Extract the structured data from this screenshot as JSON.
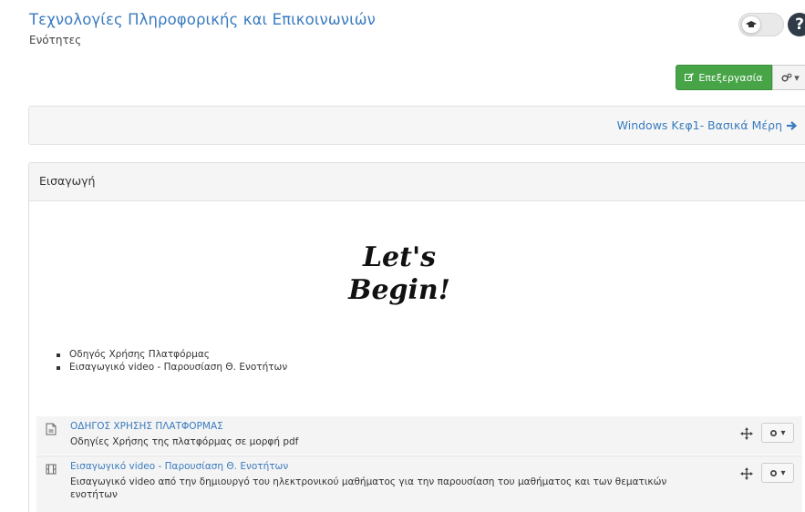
{
  "header": {
    "title": "Τεχνολογίες Πληροφορικής και Επικοινωνιών",
    "subtitle": "Ενότητες"
  },
  "toolbar": {
    "edit_label": "Επεξεργασία",
    "toggle_icon": "graduation-cap-icon",
    "help_icon": "question-circle-icon",
    "help_label": "?"
  },
  "navigation": {
    "next_label": "Windows Κεφ1- Βασικά Μέρη"
  },
  "section": {
    "title": "Εισαγωγή",
    "bullets": [
      "Οδηγός Χρήσης Πλατφόρμας",
      "Εισαγωγικό video - Παρουσίαση Θ. Ενοτήτων"
    ],
    "resources": [
      {
        "icon": "pdf-file-icon",
        "title": "ΟΔΗΓΟΣ ΧΡΗΣΗΣ ΠΛΑΤΦΟΡΜΑΣ",
        "description": "Οδηγίες Χρήσης της πλατφόρμας σε μορφή pdf"
      },
      {
        "icon": "video-file-icon",
        "title": "Εισαγωγικό video - Παρουσίαση Θ. Ενοτήτων",
        "description": "Εισαγωγικό video από την δημιουργό του ηλεκτρονικού μαθήματος για την παρουσίαση του μαθήματος και των θεματικών ενοτήτων"
      }
    ]
  },
  "colors": {
    "link": "#3a7bbf",
    "edit_button": "#47a447"
  }
}
